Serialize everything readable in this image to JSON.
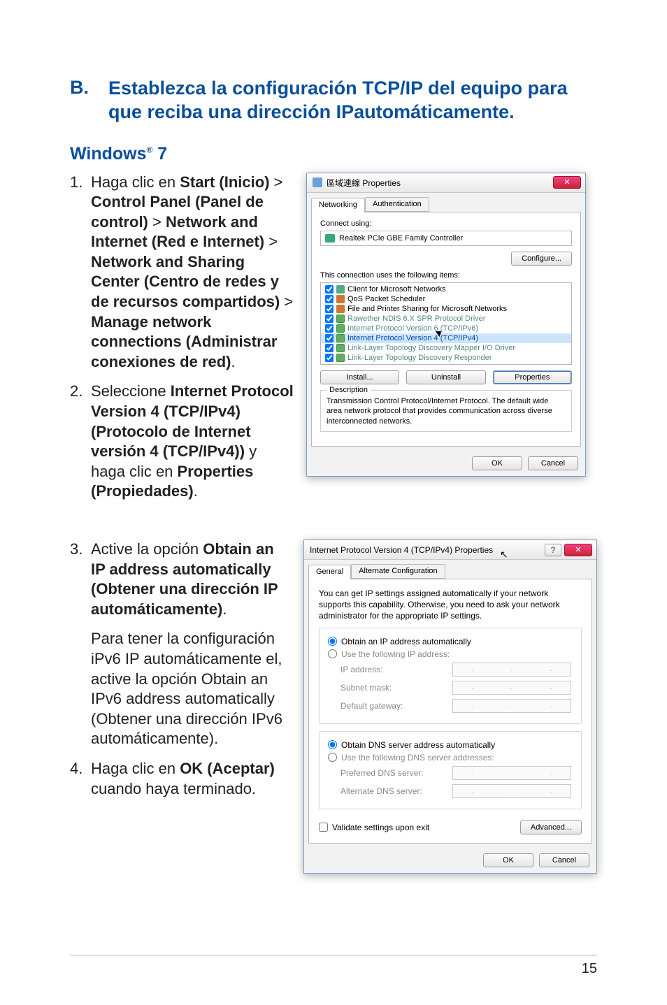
{
  "heading": {
    "letter": "B.",
    "title": "Establezca la configuración TCP/IP del equipo para que reciba una dirección IPautomáticamente."
  },
  "subheading_html": "Windows<sup>®</sup> 7",
  "step1_html": "Haga clic en <b>Start (Inicio)</b> > <b>Control Panel (Panel de control)</b> > <b>Network and Internet (Red e Internet)</b> > <b>Network and Sharing Center (Centro de redes y de recursos compartidos)</b> > <b>Manage network connections (Administrar conexiones de red)</b>.",
  "step2_html": "Seleccione <b>Internet Protocol Version 4 (TCP/IPv4) (Protocolo de Internet versión 4 (TCP/IPv4))</b> y haga clic en <b>Properties (Propiedades)</b>.",
  "step3_html": "Active la opción <b>Obtain an IP address automatically (Obtener una dirección IP automáticamente)</b>.",
  "step3b": "Para tener la configuración iPv6 IP automáticamente el, active la opción Obtain an IPv6 address automatically (Obtener una dirección IPv6 automáticamente).",
  "step4_html": "Haga clic en <b>OK (Aceptar)</b> cuando haya terminado.",
  "page_number": "15",
  "dlg1": {
    "title": "區域連線 Properties",
    "tabs": {
      "networking": "Networking",
      "auth": "Authentication"
    },
    "connect_using": "Connect using:",
    "adapter": "Realtek PCIe GBE Family Controller",
    "configure": "Configure...",
    "uses_items": "This connection uses the following items:",
    "items": [
      {
        "label": "Client for Microsoft Networks",
        "ico": "ico-client"
      },
      {
        "label": "QoS Packet Scheduler",
        "ico": "ico-qos"
      },
      {
        "label": "File and Printer Sharing for Microsoft Networks",
        "ico": "ico-file"
      },
      {
        "label": "Rawether NDIS 6.X SPR Protocol Driver",
        "ico": "ico-proto",
        "dim": true
      },
      {
        "label": "Internet Protocol Version 6 (TCP/IPv6)",
        "ico": "ico-proto",
        "dim": true
      },
      {
        "label": "Internet Protocol Version 4 (TCP/IPv4)",
        "ico": "ico-proto",
        "selected": true
      },
      {
        "label": "Link-Layer Topology Discovery Mapper I/O Driver",
        "ico": "ico-proto",
        "dim": true
      },
      {
        "label": "Link-Layer Topology Discovery Responder",
        "ico": "ico-proto",
        "dim": true
      }
    ],
    "install": "Install...",
    "uninstall": "Uninstall",
    "properties": "Properties",
    "desc_title": "Description",
    "desc": "Transmission Control Protocol/Internet Protocol. The default wide area network protocol that provides communication across diverse interconnected networks.",
    "ok": "OK",
    "cancel": "Cancel"
  },
  "dlg2": {
    "title": "Internet Protocol Version 4 (TCP/IPv4) Properties",
    "tabs": {
      "general": "General",
      "alt": "Alternate Configuration"
    },
    "intro": "You can get IP settings assigned automatically if your network supports this capability. Otherwise, you need to ask your network administrator for the appropriate IP settings.",
    "r_obtain_ip": "Obtain an IP address automatically",
    "r_use_ip": "Use the following IP address:",
    "ip_address": "IP address:",
    "subnet": "Subnet mask:",
    "gateway": "Default gateway:",
    "r_obtain_dns": "Obtain DNS server address automatically",
    "r_use_dns": "Use the following DNS server addresses:",
    "pref_dns": "Preferred DNS server:",
    "alt_dns": "Alternate DNS server:",
    "validate": "Validate settings upon exit",
    "advanced": "Advanced...",
    "ok": "OK",
    "cancel": "Cancel"
  }
}
